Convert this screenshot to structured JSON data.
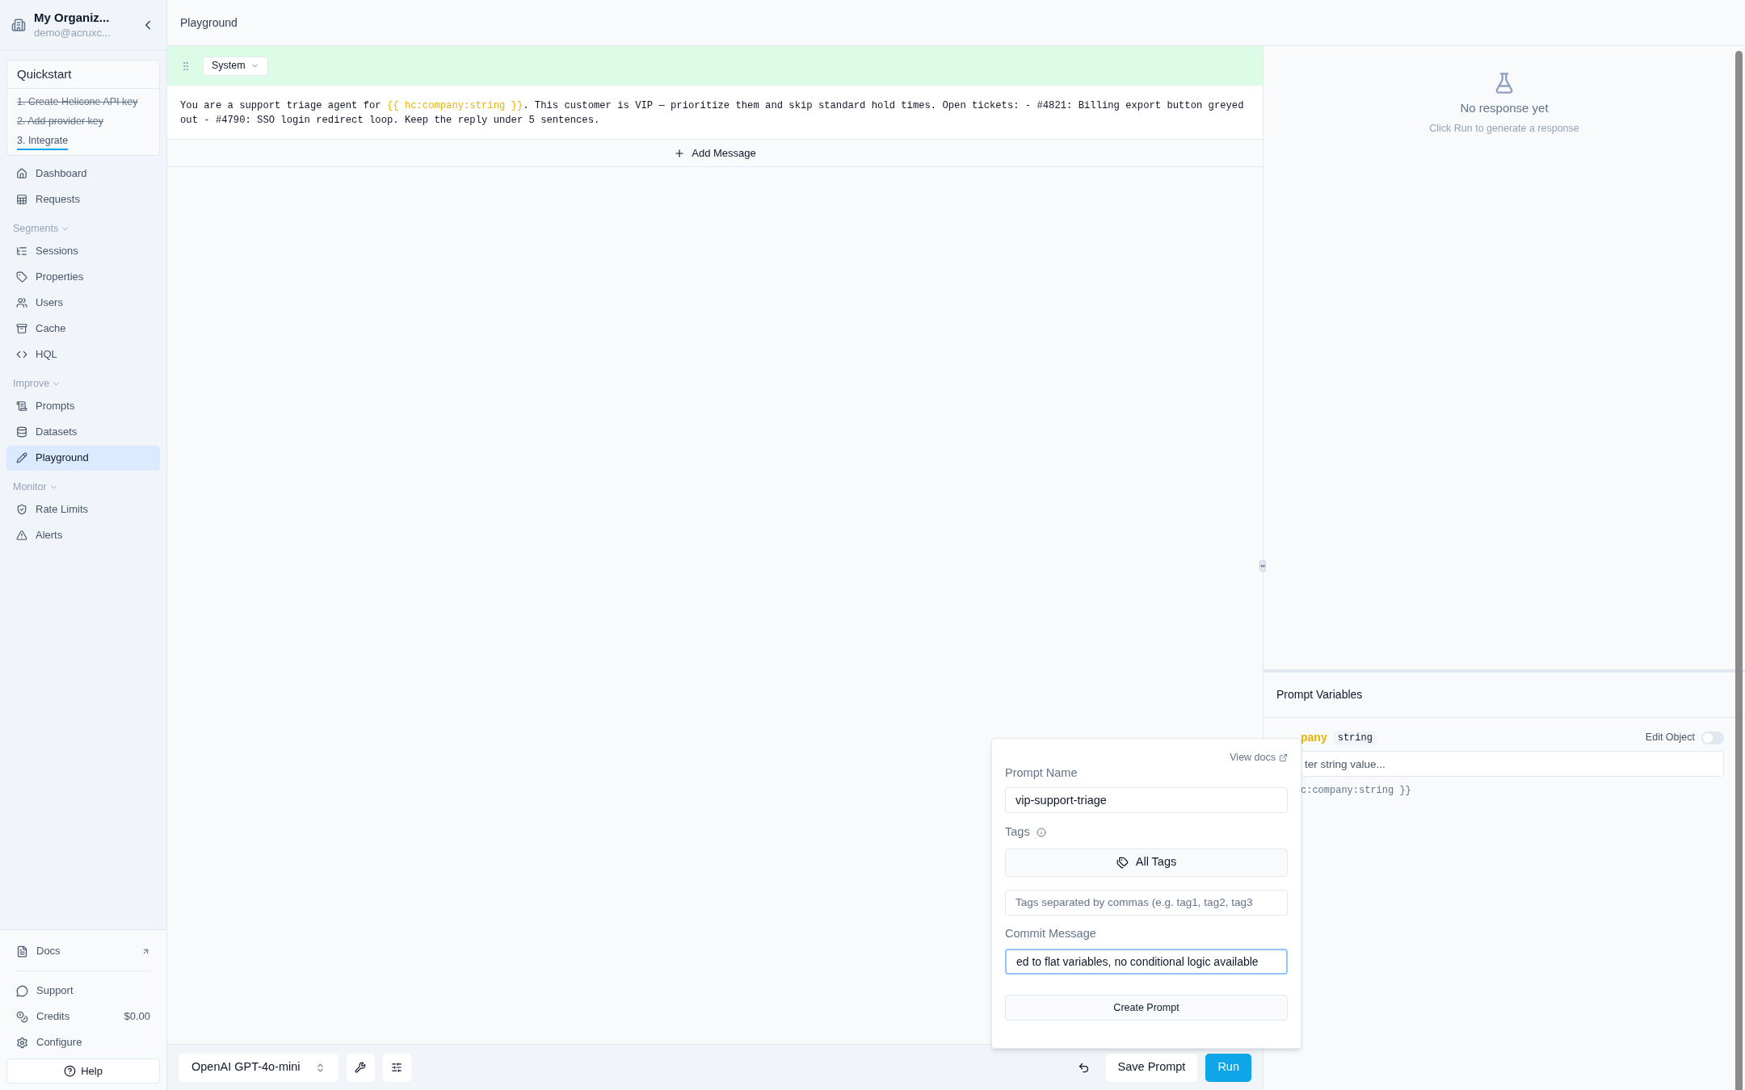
{
  "org": {
    "name": "My Organiz...",
    "email": "demo@acruxc..."
  },
  "quickstart": {
    "title": "Quickstart",
    "steps": [
      {
        "label": "1. Create Helicone API key",
        "done": true
      },
      {
        "label": "2. Add provider key",
        "done": true
      },
      {
        "label": "3. Integrate",
        "done": false
      }
    ]
  },
  "nav": [
    {
      "kind": "item",
      "label": "Dashboard",
      "selected": false
    },
    {
      "kind": "item",
      "label": "Requests",
      "selected": false
    },
    {
      "kind": "section",
      "label": "Segments"
    },
    {
      "kind": "item",
      "label": "Sessions",
      "selected": false
    },
    {
      "kind": "item",
      "label": "Properties",
      "selected": false
    },
    {
      "kind": "item",
      "label": "Users",
      "selected": false
    },
    {
      "kind": "item",
      "label": "Cache",
      "selected": false
    },
    {
      "kind": "item",
      "label": "HQL",
      "selected": false
    },
    {
      "kind": "section",
      "label": "Improve"
    },
    {
      "kind": "item",
      "label": "Prompts",
      "selected": false
    },
    {
      "kind": "item",
      "label": "Datasets",
      "selected": false
    },
    {
      "kind": "item",
      "label": "Playground",
      "selected": true
    },
    {
      "kind": "section",
      "label": "Monitor"
    },
    {
      "kind": "item",
      "label": "Rate Limits",
      "selected": false
    },
    {
      "kind": "item",
      "label": "Alerts",
      "selected": false
    }
  ],
  "docs": {
    "label": "Docs"
  },
  "footer": [
    {
      "label": "Support"
    },
    {
      "label": "Credits",
      "value": "$0.00"
    },
    {
      "label": "Configure"
    }
  ],
  "help": "Help",
  "page_title": "Playground",
  "messages": [
    {
      "role": "System",
      "segments": [
        {
          "kind": "text",
          "text": "You are a support triage agent for "
        },
        {
          "kind": "variable",
          "text": "{{ hc:company:string }}"
        },
        {
          "kind": "text",
          "text": ". This customer is VIP — prioritize them and skip standard hold times. Open tickets: - #4821: Billing export button greyed out - #4790: SSO login redirect loop. Keep the reply under 5 sentences."
        }
      ]
    }
  ],
  "add_message": "Add Message",
  "response": {
    "title": "No response yet",
    "hint": "Click Run to generate a response"
  },
  "variables": {
    "title": "Prompt Variables",
    "items": [
      {
        "name": "pany",
        "type": "string",
        "edit_label": "Edit Object",
        "on": false,
        "placeholder": "ter string value...",
        "token": "c:company:string }}"
      }
    ]
  },
  "toolbar": {
    "model": "OpenAI GPT-4o-mini",
    "save": "Save Prompt",
    "run": "Run"
  },
  "save_dialog": {
    "docs_link": "View docs",
    "name_label": "Prompt Name",
    "name_value": "vip-support-triage",
    "tags_label": "Tags",
    "all_tags": "All Tags",
    "tags_placeholder": "Tags separated by commas (e.g. tag1, tag2, tag3",
    "commit_label": "Commit Message",
    "commit_value": "ed to flat variables, no conditional logic available",
    "commit_focused": true,
    "create": "Create Prompt"
  }
}
